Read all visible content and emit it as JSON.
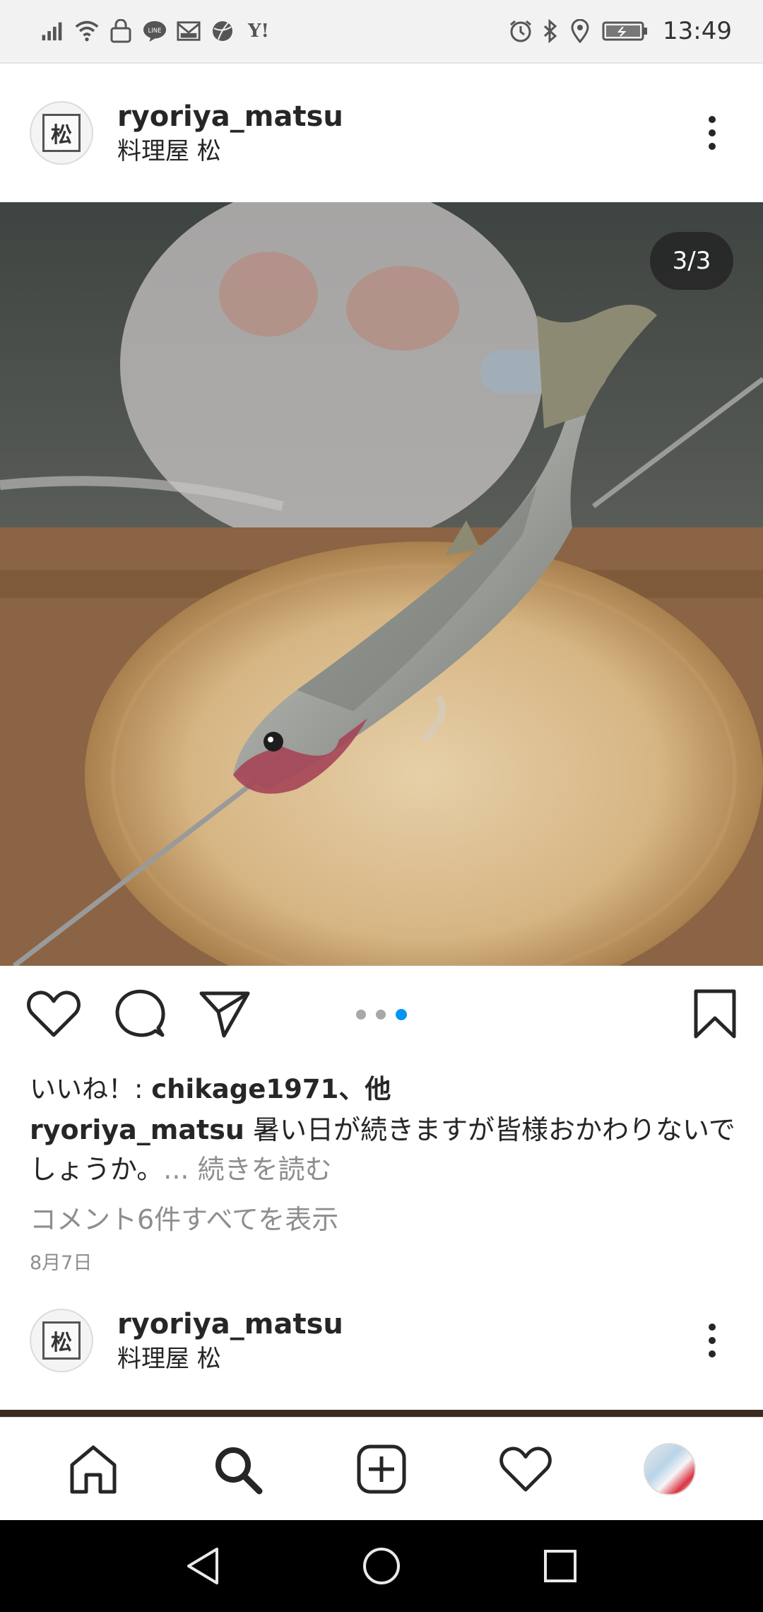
{
  "status_bar": {
    "time": "13:49",
    "left_icons": [
      "signal-icon",
      "wifi-icon",
      "lock-car-icon",
      "line-icon",
      "mail-icon",
      "ball-icon",
      "yahoo-icon"
    ],
    "yahoo_text": "Y!",
    "line_text": "LINE",
    "right_icons": [
      "alarm-icon",
      "bluetooth-icon",
      "location-icon",
      "battery-icon"
    ]
  },
  "post": {
    "username": "ryoriya_matsu",
    "location": "料理屋 松",
    "avatar_char": "松",
    "image_counter": "3/3",
    "carousel": {
      "count": 3,
      "active_index": 2
    },
    "likes_prefix": "いいね！: ",
    "likes_user": "chikage1971",
    "likes_suffix": "、他",
    "caption_user": "ryoriya_matsu",
    "caption_text": " 暑い日が続きますが皆様おかわりないでしょうか。",
    "caption_more": "... 続きを読む",
    "comments_link": "コメント6件すべてを表示",
    "date": "8月7日"
  },
  "next_post": {
    "username": "ryoriya_matsu",
    "location": "料理屋 松",
    "avatar_char": "松"
  },
  "bottom_nav": [
    "home-icon",
    "search-icon",
    "new-post-icon",
    "activity-icon",
    "profile-avatar"
  ],
  "colors": {
    "accent": "#0095f6",
    "text": "#262626",
    "muted": "#8e8e8e"
  }
}
